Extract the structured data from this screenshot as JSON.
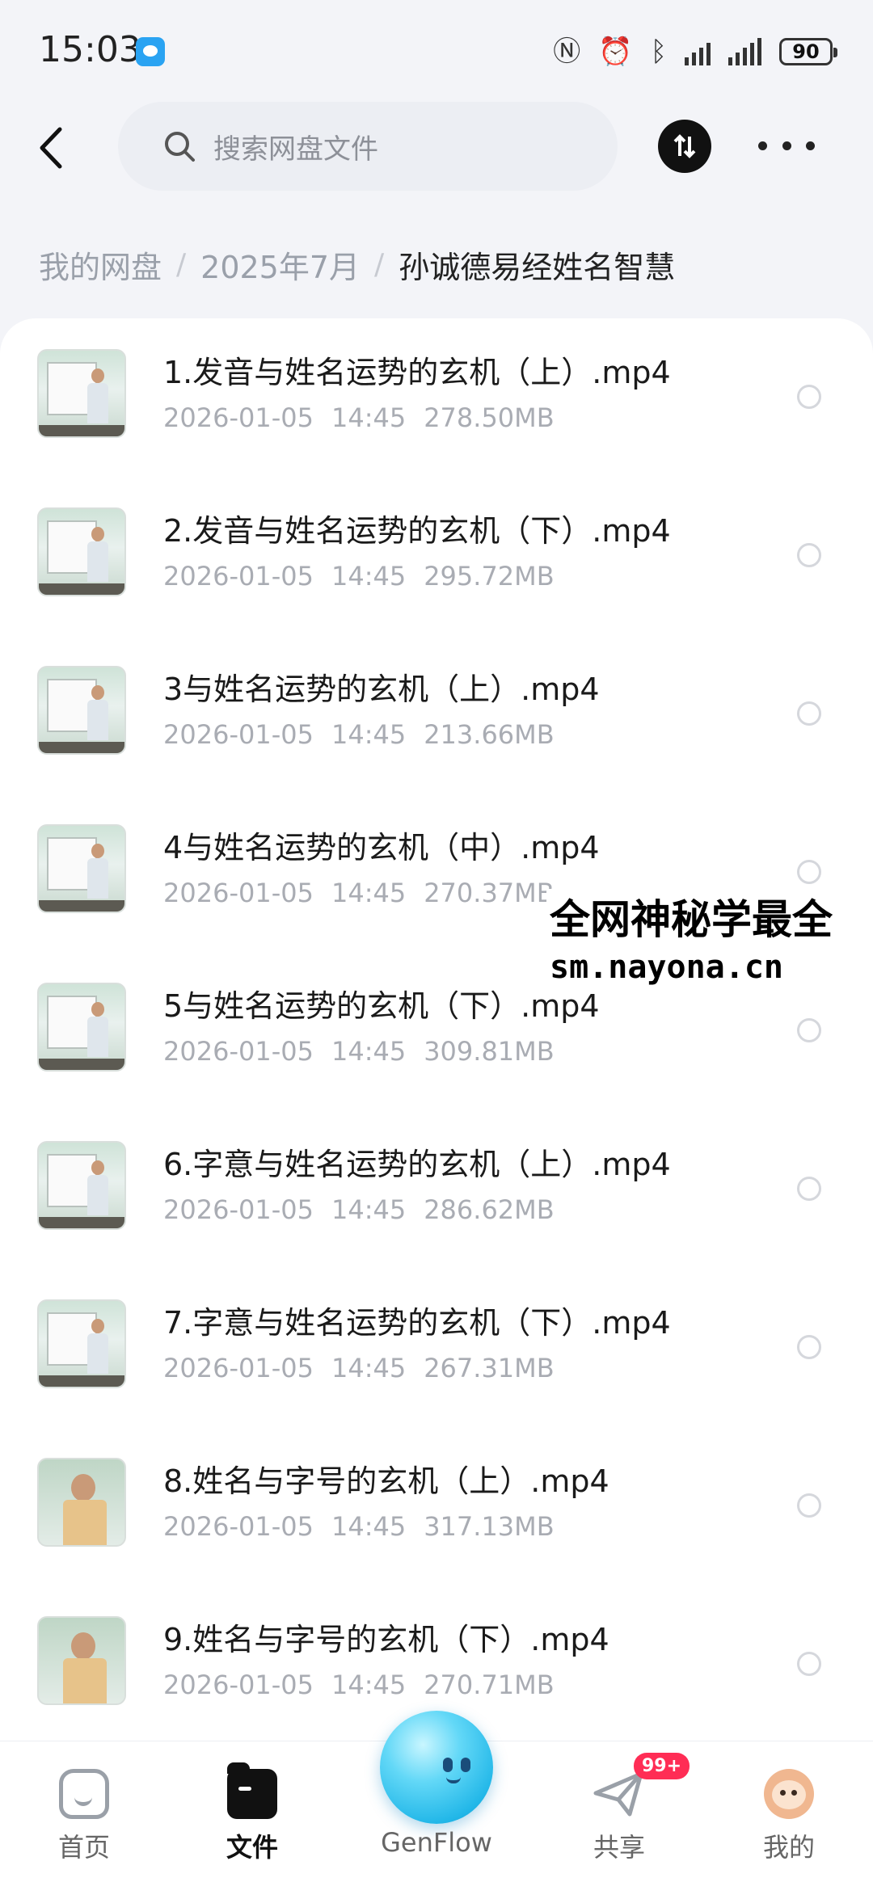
{
  "status_bar": {
    "time": "15:03",
    "battery": "90"
  },
  "search": {
    "placeholder": "搜索网盘文件"
  },
  "breadcrumb": {
    "root": "我的网盘",
    "folder": "2025年7月",
    "current": "孙诚德易经姓名智慧"
  },
  "files": [
    {
      "name": "1.发音与姓名运势的玄机（上）.mp4",
      "date": "2026-01-05",
      "time": "14:45",
      "size": "278.50MB"
    },
    {
      "name": "2.发音与姓名运势的玄机（下）.mp4",
      "date": "2026-01-05",
      "time": "14:45",
      "size": "295.72MB"
    },
    {
      "name": "3与姓名运势的玄机（上）.mp4",
      "date": "2026-01-05",
      "time": "14:45",
      "size": "213.66MB"
    },
    {
      "name": "4与姓名运势的玄机（中）.mp4",
      "date": "2026-01-05",
      "time": "14:45",
      "size": "270.37MB"
    },
    {
      "name": "5与姓名运势的玄机（下）.mp4",
      "date": "2026-01-05",
      "time": "14:45",
      "size": "309.81MB"
    },
    {
      "name": "6.字意与姓名运势的玄机（上）.mp4",
      "date": "2026-01-05",
      "time": "14:45",
      "size": "286.62MB"
    },
    {
      "name": "7.字意与姓名运势的玄机（下）.mp4",
      "date": "2026-01-05",
      "time": "14:45",
      "size": "267.31MB"
    },
    {
      "name": "8.姓名与字号的玄机（上）.mp4",
      "date": "2026-01-05",
      "time": "14:45",
      "size": "317.13MB"
    },
    {
      "name": "9.姓名与字号的玄机（下）.mp4",
      "date": "2026-01-05",
      "time": "14:45",
      "size": "270.71MB"
    }
  ],
  "watermark": {
    "line1": "全网神秘学最全",
    "line2": "sm.nayona.cn"
  },
  "nav": {
    "home": "首页",
    "files": "文件",
    "genflow": "GenFlow",
    "share": "共享",
    "mine": "我的",
    "share_badge": "99+"
  },
  "colors": {
    "accent": "#111111",
    "badge": "#ff2d55",
    "meta_text": "#a9acb3",
    "genflow": "#22b7e8"
  }
}
